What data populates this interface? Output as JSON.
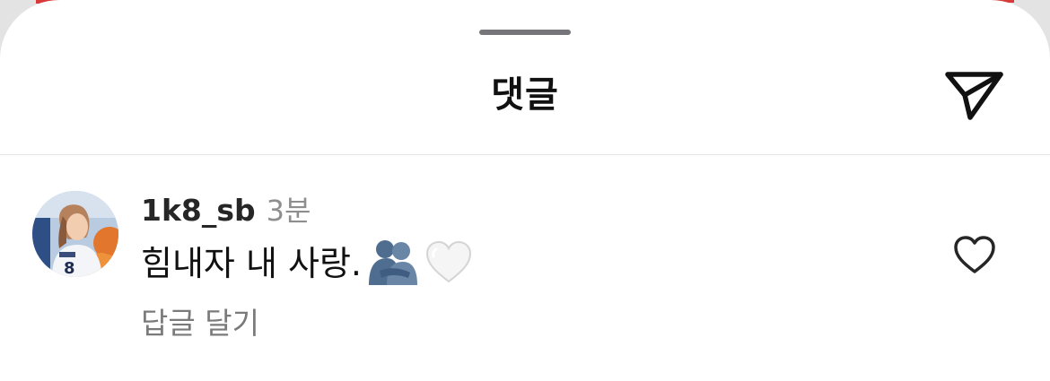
{
  "header": {
    "title": "댓글",
    "share_icon": "send-icon"
  },
  "comment": {
    "avatar_icon": "user-avatar",
    "username": "1k8_sb",
    "timestamp": "3분",
    "text": "힘내자 내 사랑.",
    "emojis": [
      "people-hugging-emoji",
      "white-heart-emoji"
    ],
    "reply_label": "답글 달기",
    "like_icon": "heart-outline-icon"
  },
  "colors": {
    "accent": "#d83a3a",
    "text_primary": "#111111",
    "text_secondary": "#8e8e8e",
    "divider": "#e6e6e6"
  }
}
